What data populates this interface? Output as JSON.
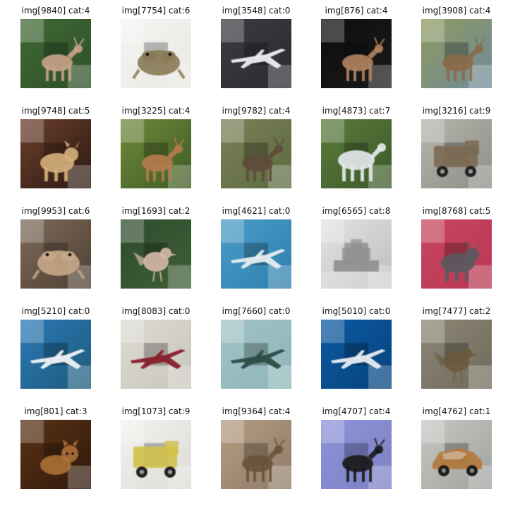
{
  "tiles": [
    {
      "id": "9840",
      "cat": "4",
      "label": "img[9840] cat:4",
      "subject": "deer",
      "colors": {
        "bg": "#3f6a35",
        "bg2": "#2e4f28",
        "fg": "#c9a489"
      }
    },
    {
      "id": "7754",
      "cat": "6",
      "label": "img[7754] cat:6",
      "subject": "frog",
      "colors": {
        "bg": "#f4f4f2",
        "bg2": "#e9e8e4",
        "fg": "#8a7a55"
      }
    },
    {
      "id": "3548",
      "cat": "0",
      "label": "img[3548] cat:0",
      "subject": "airplane",
      "colors": {
        "bg": "#3d3b41",
        "bg2": "#2c2a30",
        "fg": "#eceef2"
      }
    },
    {
      "id": "876",
      "cat": "4",
      "label": "img[876] cat:4",
      "subject": "deer",
      "colors": {
        "bg": "#0d0d0d",
        "bg2": "#1a1a1a",
        "fg": "#b2845f"
      }
    },
    {
      "id": "3908",
      "cat": "4",
      "label": "img[3908] cat:4",
      "subject": "deer",
      "colors": {
        "bg": "#8f9a5c",
        "bg2": "#6e8a9c",
        "fg": "#8b6a48"
      }
    },
    {
      "id": "9748",
      "cat": "5",
      "label": "img[9748] cat:5",
      "subject": "dog",
      "colors": {
        "bg": "#6b3e2a",
        "bg2": "#2b1a12",
        "fg": "#d6b07b"
      }
    },
    {
      "id": "3225",
      "cat": "4",
      "label": "img[3225] cat:4",
      "subject": "deer",
      "colors": {
        "bg": "#6e8a3b",
        "bg2": "#3f5b23",
        "fg": "#b77b4e"
      }
    },
    {
      "id": "9782",
      "cat": "4",
      "label": "img[9782] cat:4",
      "subject": "deer",
      "colors": {
        "bg": "#7c7f57",
        "bg2": "#5b6b3f",
        "fg": "#5e4a3b"
      }
    },
    {
      "id": "4873",
      "cat": "7",
      "label": "img[4873] cat:7",
      "subject": "horse",
      "colors": {
        "bg": "#5b7b3d",
        "bg2": "#3b5a28",
        "fg": "#e8e9ee"
      }
    },
    {
      "id": "3216",
      "cat": "9",
      "label": "img[3216] cat:9",
      "subject": "truck",
      "colors": {
        "bg": "#b5b6ad",
        "bg2": "#8e8c86",
        "fg": "#7b6a52"
      }
    },
    {
      "id": "9953",
      "cat": "6",
      "label": "img[9953] cat:6",
      "subject": "frog",
      "colors": {
        "bg": "#7d6a58",
        "bg2": "#4e3f33",
        "fg": "#c7a788"
      }
    },
    {
      "id": "1693",
      "cat": "2",
      "label": "img[1693] cat:2",
      "subject": "bird",
      "colors": {
        "bg": "#2e4b2d",
        "bg2": "#3e5f36",
        "fg": "#d7b9a8"
      }
    },
    {
      "id": "4621",
      "cat": "0",
      "label": "img[4621] cat:0",
      "subject": "airplane",
      "colors": {
        "bg": "#4a9dc7",
        "bg2": "#2f7fae",
        "fg": "#e7eef1"
      }
    },
    {
      "id": "6565",
      "cat": "8",
      "label": "img[6565] cat:8",
      "subject": "ship",
      "colors": {
        "bg": "#e4e4e4",
        "bg2": "#bdbdbd",
        "fg": "#8f8f8f"
      }
    },
    {
      "id": "8768",
      "cat": "5",
      "label": "img[8768] cat:5",
      "subject": "dog",
      "colors": {
        "bg": "#c9455f",
        "bg2": "#b83853",
        "fg": "#5a5a5f"
      }
    },
    {
      "id": "5210",
      "cat": "0",
      "label": "img[5210] cat:0",
      "subject": "airplane",
      "colors": {
        "bg": "#2b78b6",
        "bg2": "#1e5b7a",
        "fg": "#f0f2f5"
      }
    },
    {
      "id": "8083",
      "cat": "0",
      "label": "img[8083] cat:0",
      "subject": "airplane",
      "colors": {
        "bg": "#dcdad2",
        "bg2": "#c9c6bc",
        "fg": "#8a1f2a"
      }
    },
    {
      "id": "7660",
      "cat": "0",
      "label": "img[7660] cat:0",
      "subject": "airplane",
      "colors": {
        "bg": "#9fc2c6",
        "bg2": "#8fb6ba",
        "fg": "#2c4b45"
      }
    },
    {
      "id": "5010",
      "cat": "0",
      "label": "img[5010] cat:0",
      "subject": "airplane",
      "colors": {
        "bg": "#0d59a2",
        "bg2": "#06437c",
        "fg": "#e8ecf0"
      }
    },
    {
      "id": "7477",
      "cat": "2",
      "label": "img[7477] cat:2",
      "subject": "bird",
      "colors": {
        "bg": "#8c8675",
        "bg2": "#6f6a5b",
        "fg": "#6b5a3f"
      }
    },
    {
      "id": "801",
      "cat": "3",
      "label": "img[801] cat:3",
      "subject": "cat",
      "colors": {
        "bg": "#5b3216",
        "bg2": "#2f190b",
        "fg": "#b2743b"
      }
    },
    {
      "id": "1073",
      "cat": "9",
      "label": "img[1073] cat:9",
      "subject": "truck",
      "colors": {
        "bg": "#f2f2ef",
        "bg2": "#dcdbd6",
        "fg": "#d2c14a"
      }
    },
    {
      "id": "9364",
      "cat": "4",
      "label": "img[9364] cat:4",
      "subject": "deer",
      "colors": {
        "bg": "#b59d83",
        "bg2": "#8d7b67",
        "fg": "#6b513c"
      }
    },
    {
      "id": "4707",
      "cat": "4",
      "label": "img[4707] cat:4",
      "subject": "deer",
      "colors": {
        "bg": "#8f93d8",
        "bg2": "#7b80c5",
        "fg": "#1a1a1a"
      }
    },
    {
      "id": "4762",
      "cat": "1",
      "label": "img[4762] cat:1",
      "subject": "automobile",
      "colors": {
        "bg": "#c7c8c4",
        "bg2": "#9fa29d",
        "fg": "#b37a3e"
      }
    }
  ]
}
